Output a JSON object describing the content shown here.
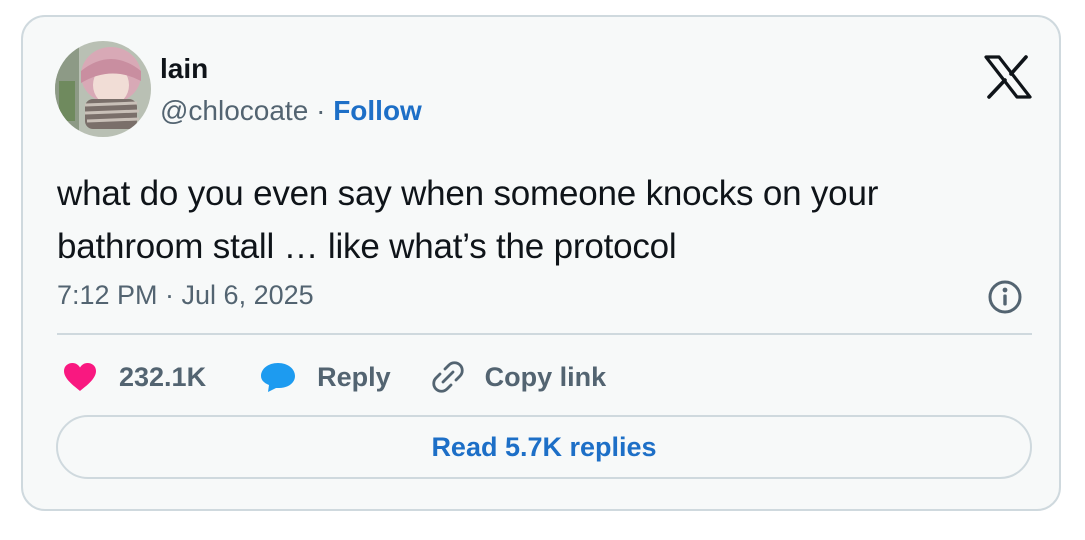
{
  "author": {
    "display_name": "lain",
    "handle": "@chlocoate",
    "separator": " · ",
    "follow_label": "Follow"
  },
  "tweet": {
    "text_line1": "what do you even say when someone knocks on your",
    "text_line2": "bathroom stall … like what’s the protocol",
    "timestamp": "7:12 PM · Jul 6, 2025"
  },
  "actions": {
    "likes_count": "232.1K",
    "reply_label": "Reply",
    "copy_link_label": "Copy link"
  },
  "read_replies_label": "Read 5.7K replies",
  "icons": {
    "brand": "x-logo-icon",
    "info": "info-icon",
    "like": "heart-icon",
    "reply": "speech-bubble-icon",
    "copy": "link-icon"
  },
  "colors": {
    "card_background": "#f7f9f9",
    "border": "#cfd9de",
    "text_primary": "#0f1419",
    "text_secondary": "#536471",
    "link_blue": "#1d6fc7",
    "heart_pink": "#f91880",
    "reply_blue": "#1d9bf0"
  }
}
